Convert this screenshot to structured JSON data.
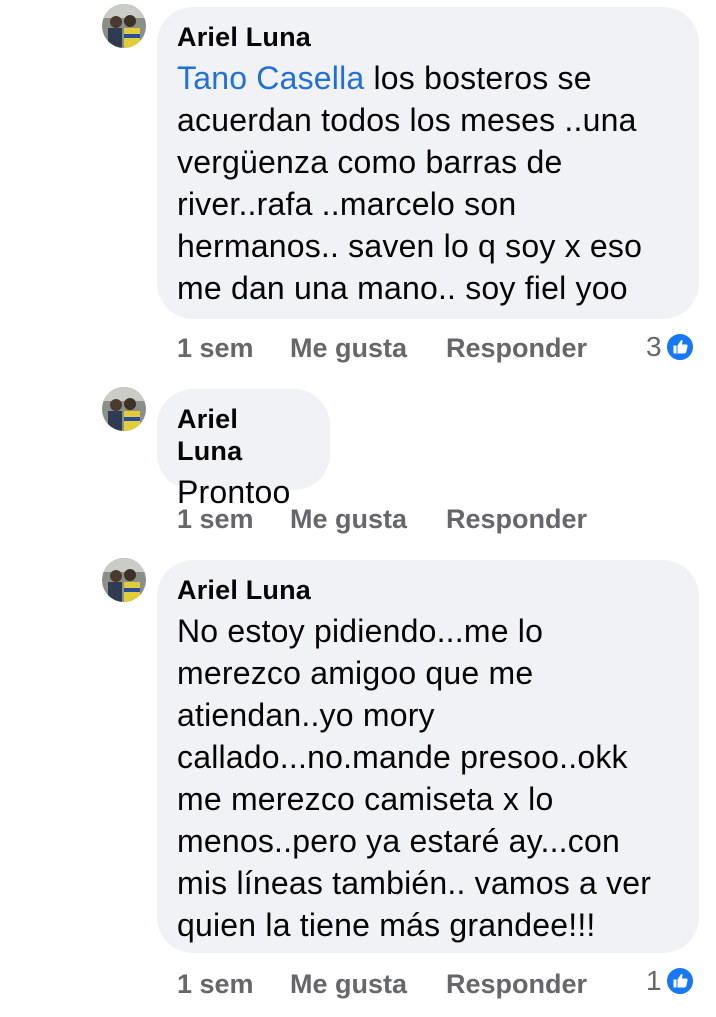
{
  "comments": [
    {
      "author": "Ariel Luna",
      "mention": "Tano Casella",
      "text": " los bosteros se\nacuerdan todos los meses ..una\nvergüenza como barras de\nriver..rafa ..marcelo son\nhermanos.. saven lo q soy x eso\nme dan una mano.. soy fiel yoo",
      "time": "1 sem",
      "like_label": "Me gusta",
      "reply_label": "Responder",
      "reaction_count": "3",
      "reaction_icon": "like-icon"
    },
    {
      "author": "Ariel Luna",
      "text": "Prontoo",
      "time": "1 sem",
      "like_label": "Me gusta",
      "reply_label": "Responder"
    },
    {
      "author": "Ariel Luna",
      "text": "No estoy pidiendo...me lo\nmerezco amigoo que me\natiendan..yo mory\ncallado...no.mande presoo..okk\nme merezco camiseta x lo\nmenos..pero ya estaré ay...con\nmis líneas también.. vamos a ver\nquien la tiene más grandee!!!",
      "time": "1 sem",
      "like_label": "Me gusta",
      "reply_label": "Responder",
      "reaction_count": "1",
      "reaction_icon": "like-icon"
    }
  ],
  "colors": {
    "bubble_bg": "#f0f2f5",
    "mention": "#216fdb",
    "meta_text": "#65676b",
    "like_blue": "#1877f2"
  }
}
